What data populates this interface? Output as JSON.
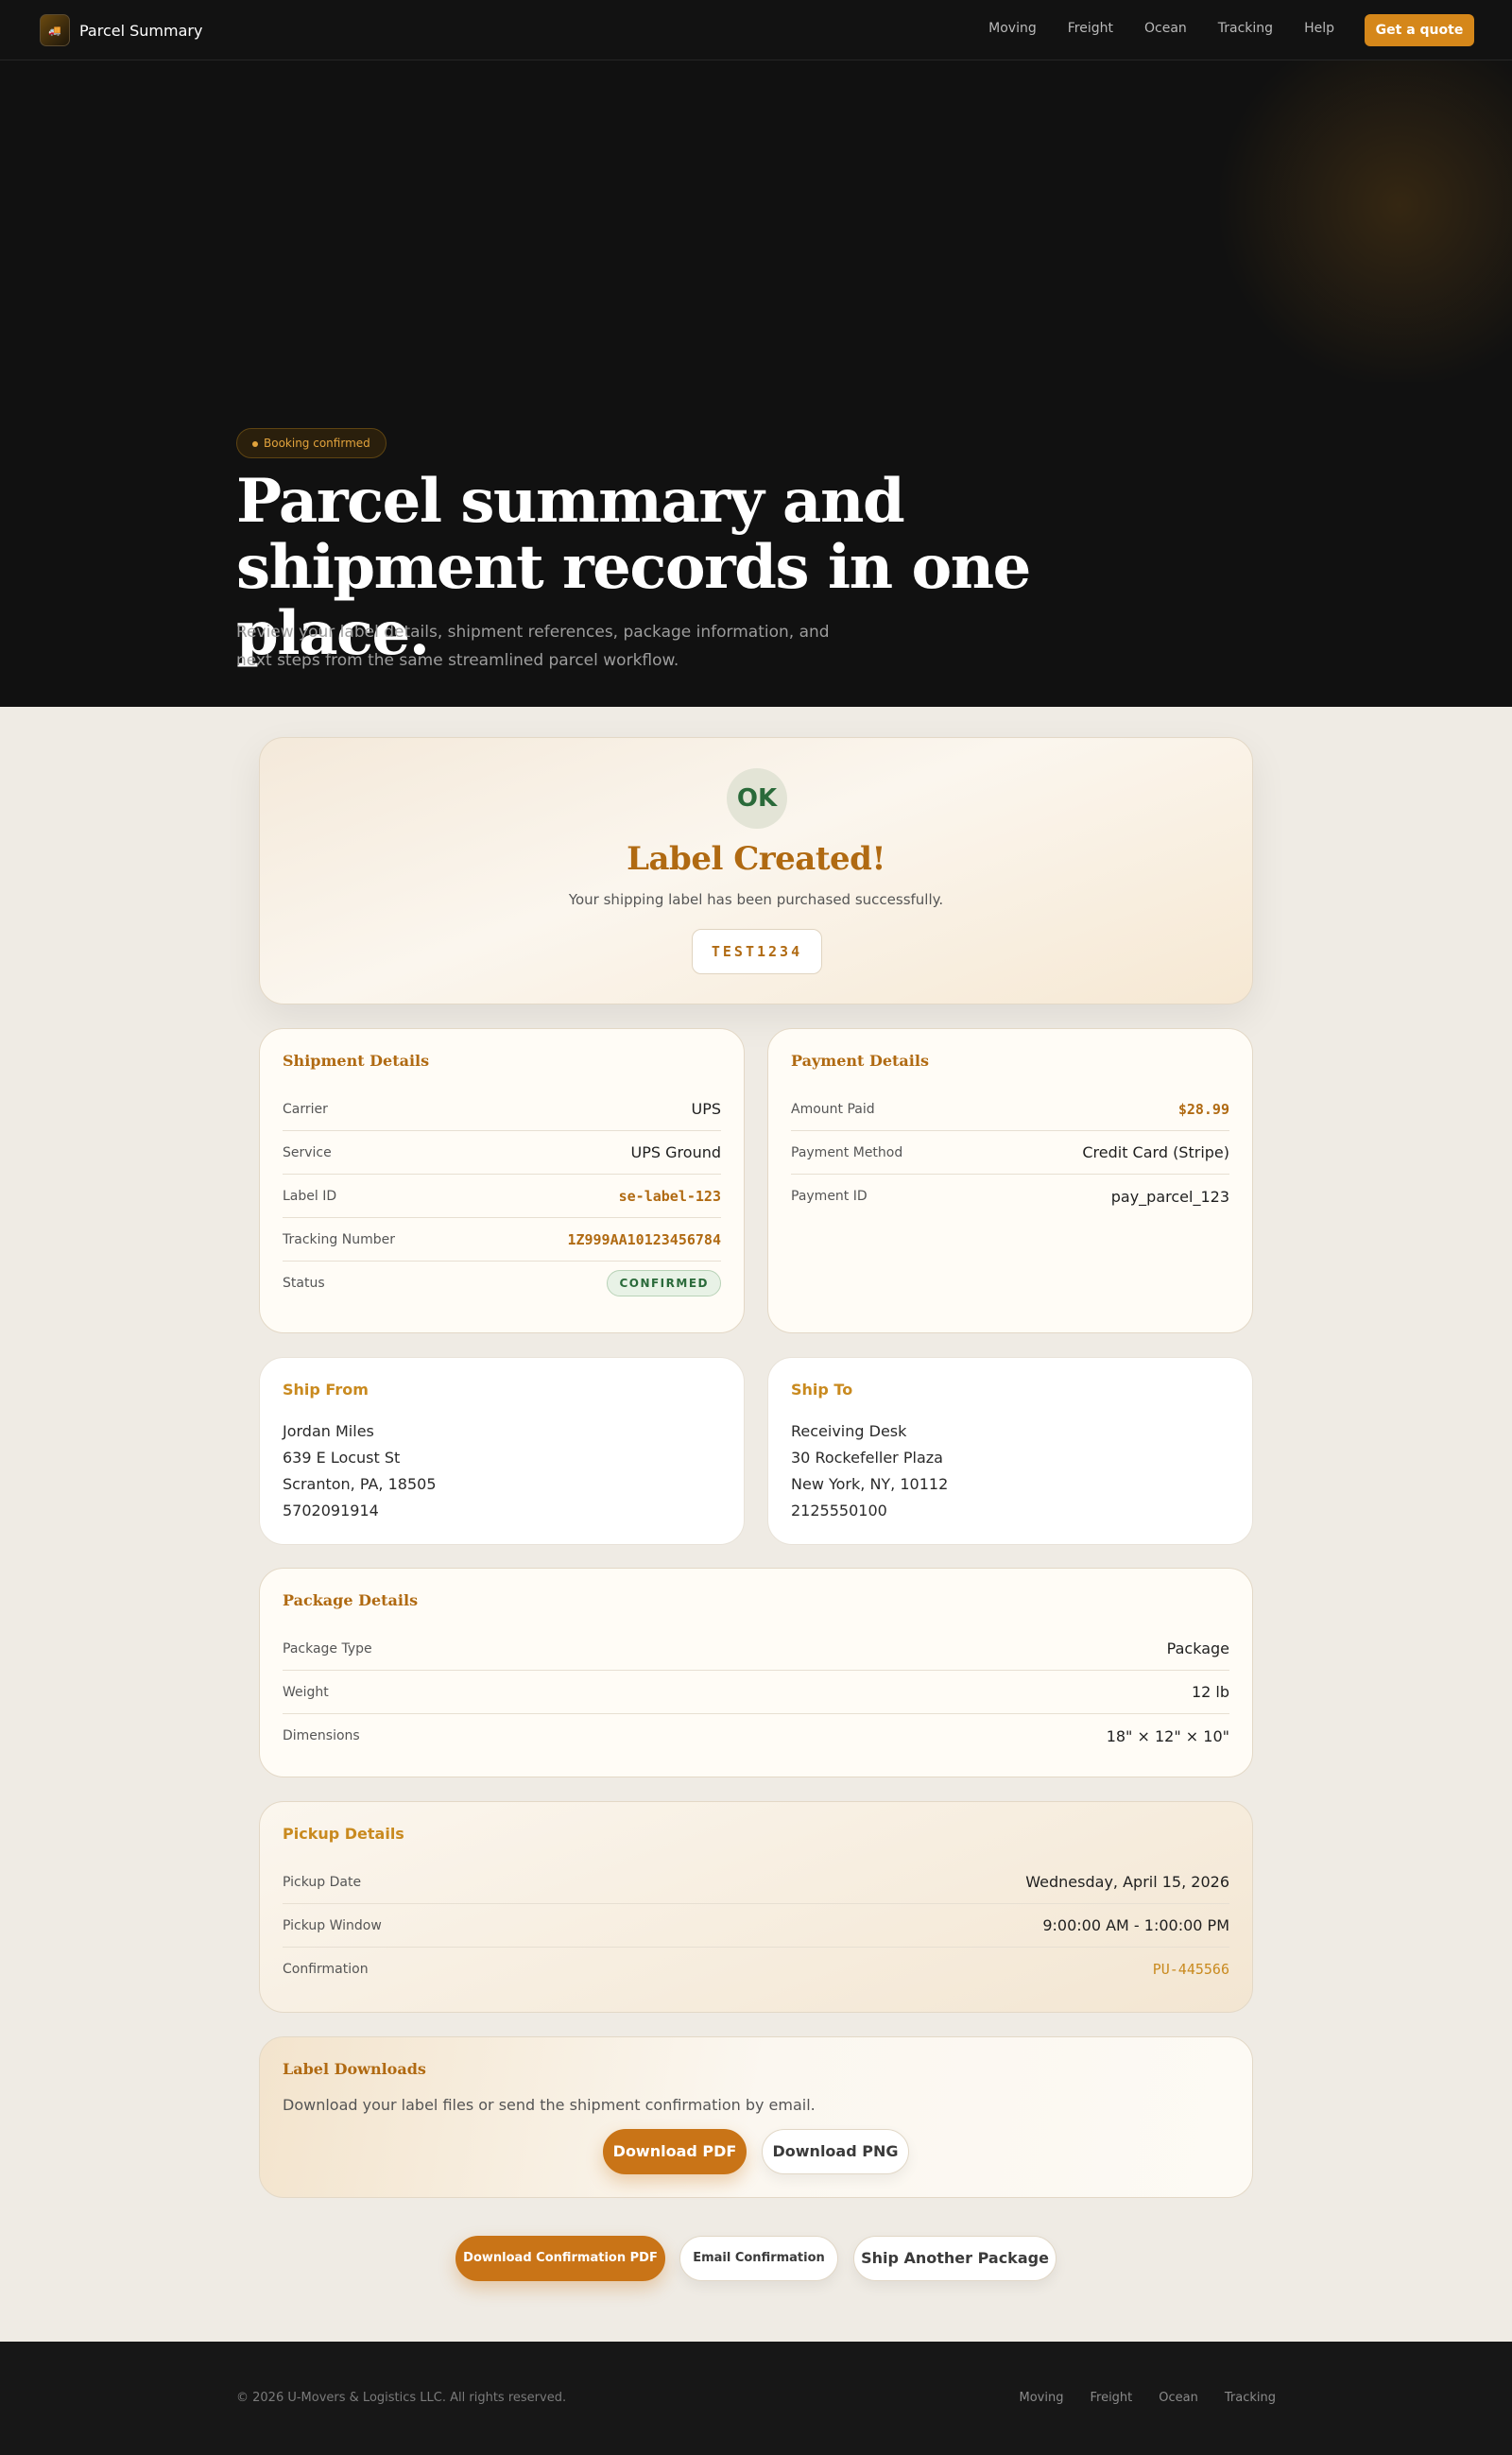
{
  "nav": {
    "brand": "Parcel Summary",
    "links": [
      "Moving",
      "Freight",
      "Ocean",
      "Tracking",
      "Help"
    ],
    "cta": "Get a quote"
  },
  "hero": {
    "badge": "Booking confirmed",
    "title": "Parcel summary and shipment records in one place.",
    "subtitle": "Review your label details, shipment references, package information, and next steps from the same streamlined parcel workflow."
  },
  "confirmation": {
    "icon_text": "OK",
    "title": "Label Created!",
    "subtitle": "Your shipping label has been purchased successfully.",
    "tracking_ref": "TEST1234"
  },
  "shipment": {
    "title": "Shipment Details",
    "rows": [
      {
        "label": "Carrier",
        "value": "UPS"
      },
      {
        "label": "Service",
        "value": "UPS Ground"
      },
      {
        "label": "Label ID",
        "value": "se-label-123"
      },
      {
        "label": "Tracking Number",
        "value": "1Z999AA10123456784"
      },
      {
        "label": "Status",
        "value": "CONFIRMED"
      }
    ]
  },
  "payment": {
    "title": "Payment Details",
    "rows": [
      {
        "label": "Amount Paid",
        "value": "$28.99"
      },
      {
        "label": "Payment Method",
        "value": "Credit Card (Stripe)"
      },
      {
        "label": "Payment ID",
        "value": "pay_parcel_123"
      }
    ]
  },
  "ship_from": {
    "title": "Ship From",
    "lines": [
      "Jordan Miles",
      "639 E Locust St",
      "Scranton, PA, 18505",
      "5702091914"
    ]
  },
  "ship_to": {
    "title": "Ship To",
    "lines": [
      "Receiving Desk",
      "30 Rockefeller Plaza",
      "New York, NY, 10112",
      "2125550100"
    ]
  },
  "package": {
    "title": "Package Details",
    "rows": [
      {
        "label": "Package Type",
        "value": "Package"
      },
      {
        "label": "Weight",
        "value": "12 lb"
      },
      {
        "label": "Dimensions",
        "value": "18\" × 12\" × 10\""
      }
    ]
  },
  "pickup": {
    "title": "Pickup Details",
    "rows": [
      {
        "label": "Pickup Date",
        "value": "Wednesday, April 15, 2026"
      },
      {
        "label": "Pickup Window",
        "value": "9:00:00 AM - 1:00:00 PM"
      },
      {
        "label": "Confirmation",
        "value": "PU-445566"
      }
    ]
  },
  "downloads": {
    "title": "Label Downloads",
    "text": "Download your label files or send the shipment confirmation by email.",
    "pdf": "Download PDF",
    "png": "Download PNG"
  },
  "actions": {
    "confirmation_pdf": "Download Confirmation PDF",
    "email": "Email Confirmation",
    "ship_another": "Ship Another Package"
  },
  "footer": {
    "copyright": "© 2026 U-Movers & Logistics LLC. All rights reserved.",
    "links": [
      "Moving",
      "Freight",
      "Ocean",
      "Tracking"
    ]
  },
  "colors": {
    "accent": "#d5871a",
    "accent_dark": "#b06a12",
    "success": "#2a6a3a",
    "dark_bg": "#111111"
  }
}
